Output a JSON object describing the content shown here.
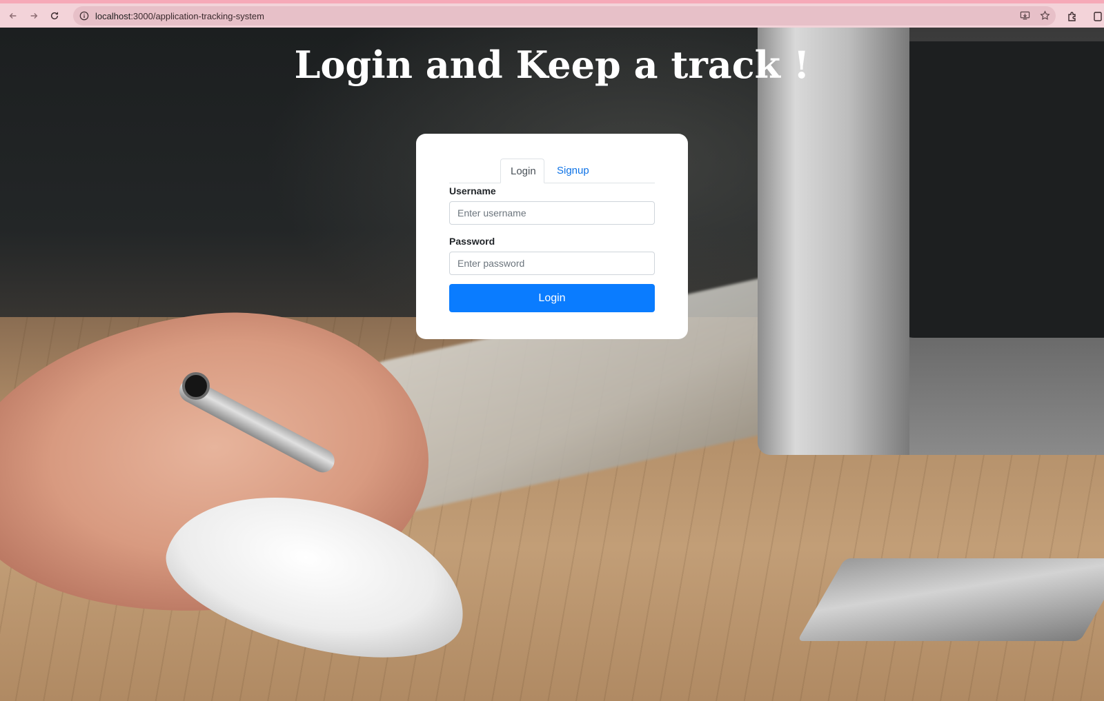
{
  "browser": {
    "url_host": "localhost",
    "url_path": ":3000/application-tracking-system"
  },
  "page": {
    "title": "Login and Keep a track !"
  },
  "login_card": {
    "tabs": [
      {
        "label": "Login",
        "active": true
      },
      {
        "label": "Signup",
        "active": false
      }
    ],
    "username": {
      "label": "Username",
      "placeholder": "Enter username",
      "value": ""
    },
    "password": {
      "label": "Password",
      "placeholder": "Enter password",
      "value": ""
    },
    "submit_label": "Login"
  },
  "colors": {
    "primary_button": "#0a7cff",
    "link_tab": "#0d72e6",
    "browser_bar": "#f3d3d9"
  },
  "icons": [
    "back-arrow-icon",
    "forward-arrow-icon",
    "reload-icon",
    "site-info-icon",
    "install-app-icon",
    "bookmark-star-icon",
    "extensions-icon"
  ]
}
